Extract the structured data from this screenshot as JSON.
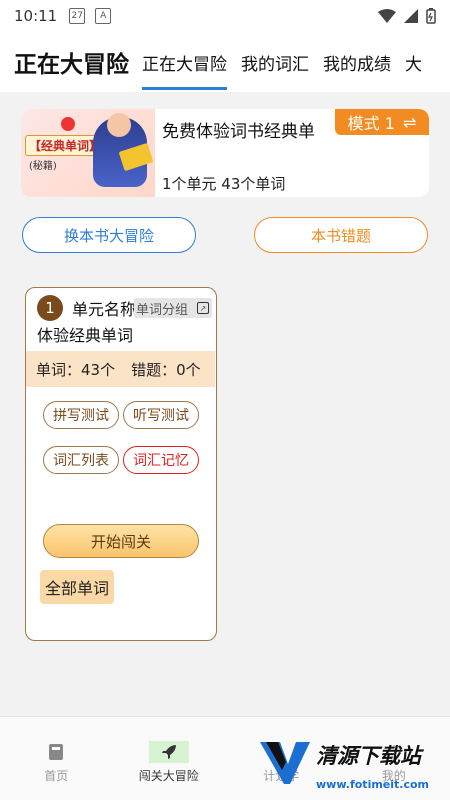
{
  "status": {
    "time": "10:11",
    "calendar_day": "27",
    "notif_letter": "A"
  },
  "header": {
    "title": "正在大冒险",
    "tabs": [
      {
        "label": "正在大冒险",
        "active": true
      },
      {
        "label": "我的词汇"
      },
      {
        "label": "我的成绩"
      },
      {
        "label": "大"
      }
    ]
  },
  "book": {
    "cover_tag": "【经典单词】",
    "cover_sub": "(秘籍)",
    "title": "免费体验词书经典单",
    "meta": "1个单元   43个单词",
    "mode_label": "模式 1",
    "mode_icon": "⇌"
  },
  "actions": {
    "change_book": "换本书大冒险",
    "book_mistakes": "本书错题"
  },
  "unit": {
    "number": "1",
    "label": "单元名称",
    "group_tag": "单词分组",
    "name": "体验经典单词",
    "words": "单词：43个",
    "mistakes": "错题：0个",
    "buttons": [
      "拼写测试",
      "听写测试",
      "词汇列表",
      "词汇记忆"
    ],
    "start": "开始闯关",
    "all_words": "全部单词"
  },
  "bottom_nav": [
    {
      "label": "首页",
      "icon": "book-icon"
    },
    {
      "label": "闯关大冒险",
      "icon": "rocket-icon",
      "active": true
    },
    {
      "label": "计划学",
      "icon": "plan-icon"
    },
    {
      "label": "我的",
      "icon": "graduation-cap-icon"
    }
  ],
  "watermark": {
    "text": "清源下载站",
    "url": "www.fotimeit.com"
  },
  "colors": {
    "accent_blue": "#2f7fd6",
    "accent_orange": "#f28c22",
    "unit_brown": "#7a4a1c"
  }
}
